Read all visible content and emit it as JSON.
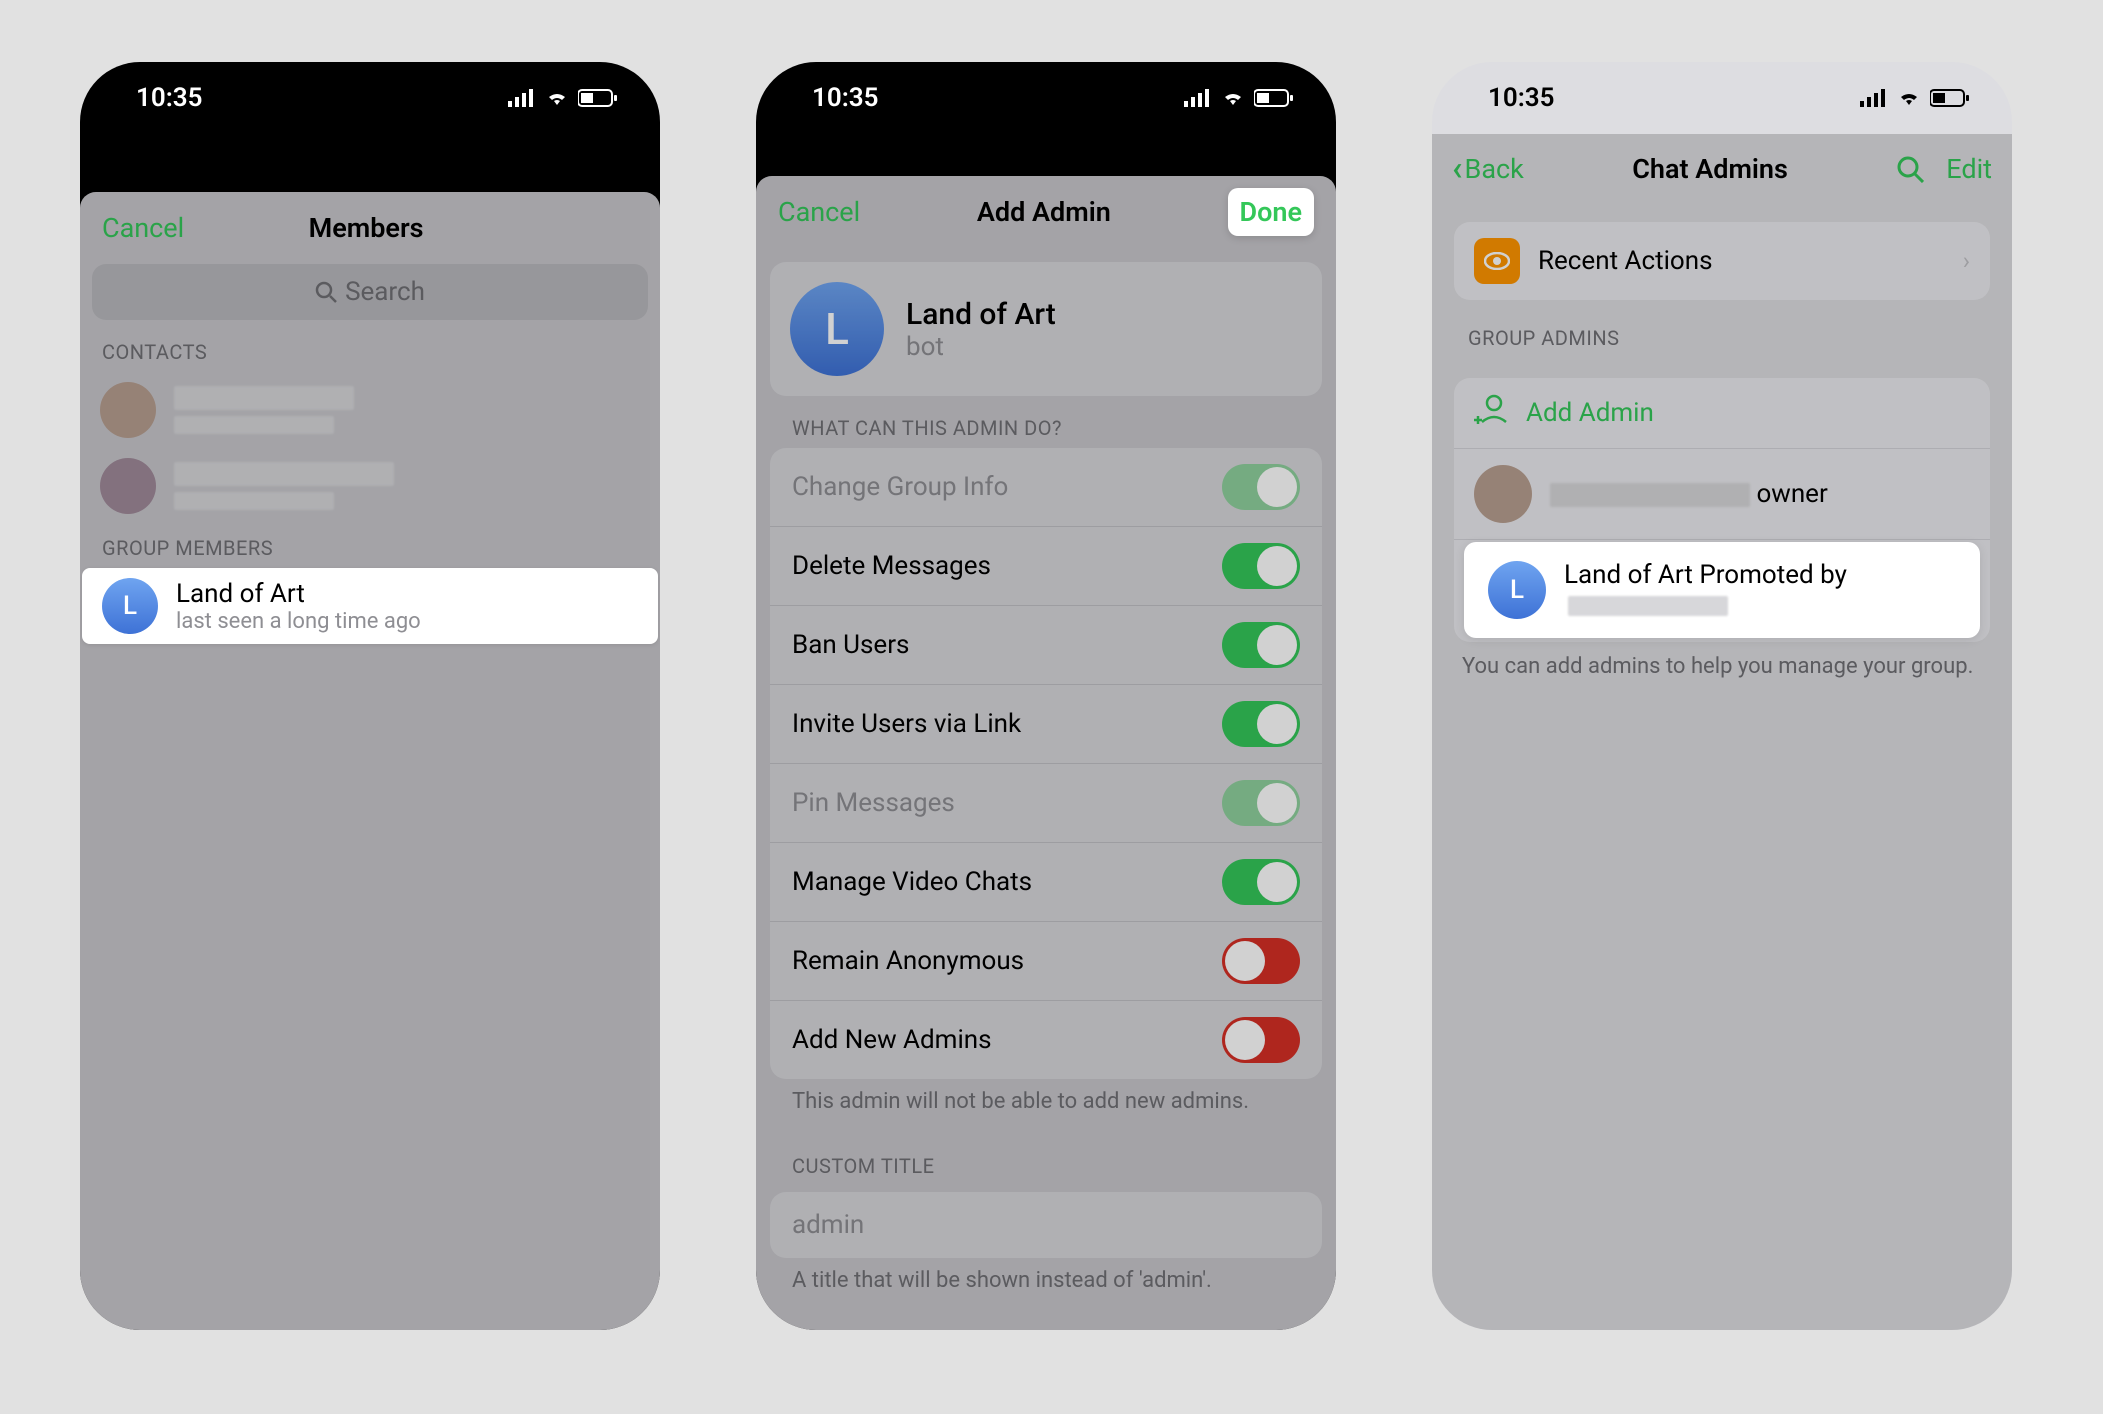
{
  "status": {
    "time": "10:35"
  },
  "screen1": {
    "cancel": "Cancel",
    "title": "Members",
    "search_placeholder": "Search",
    "section_contacts": "CONTACTS",
    "section_group_members": "GROUP MEMBERS",
    "highlighted": {
      "avatar_letter": "L",
      "name": "Land of Art",
      "sub": "last seen a long time ago"
    }
  },
  "screen2": {
    "cancel": "Cancel",
    "title": "Add Admin",
    "done": "Done",
    "member": {
      "avatar_letter": "L",
      "name": "Land of Art",
      "sub": "bot"
    },
    "section_perms": "WHAT CAN THIS ADMIN DO?",
    "perms": [
      {
        "label": "Change Group Info",
        "state": "on-dim"
      },
      {
        "label": "Delete Messages",
        "state": "on-green"
      },
      {
        "label": "Ban Users",
        "state": "on-green"
      },
      {
        "label": "Invite Users via Link",
        "state": "on-green"
      },
      {
        "label": "Pin Messages",
        "state": "on-dim"
      },
      {
        "label": "Manage Video Chats",
        "state": "on-green"
      },
      {
        "label": "Remain Anonymous",
        "state": "off-red"
      },
      {
        "label": "Add New Admins",
        "state": "off-red"
      }
    ],
    "perms_footer": "This admin will not be able to add new admins.",
    "section_title": "CUSTOM TITLE",
    "title_placeholder": "admin",
    "title_footer": "A title that will be shown instead of 'admin'."
  },
  "screen3": {
    "back": "Back",
    "title": "Chat Admins",
    "edit": "Edit",
    "recent_actions": "Recent Actions",
    "section_admins": "GROUP ADMINS",
    "add_admin": "Add Admin",
    "owner_sub": "owner",
    "highlighted": {
      "avatar_letter": "L",
      "name": "Land of Art",
      "sub_prefix": "Promoted by"
    },
    "footer": "You can add admins to help you manage your group."
  }
}
